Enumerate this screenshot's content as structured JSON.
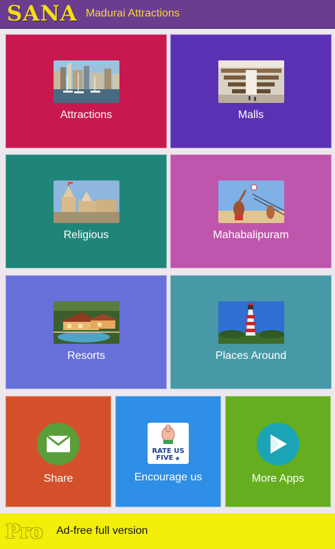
{
  "header": {
    "logo": "SANA",
    "title": "Madurai Attractions"
  },
  "tiles": [
    {
      "label": "Attractions",
      "color": "#c9174f",
      "icon": "harbor-photo-icon"
    },
    {
      "label": "Malls",
      "color": "#5b31b4",
      "icon": "mall-photo-icon"
    },
    {
      "label": "Religious",
      "color": "#1f8579",
      "icon": "temple-photo-icon"
    },
    {
      "label": "Mahabalipuram",
      "color": "#c055ad",
      "icon": "volleyball-photo-icon"
    },
    {
      "label": "Resorts",
      "color": "#6870d9",
      "icon": "resort-photo-icon"
    },
    {
      "label": "Places Around",
      "color": "#4799a7",
      "icon": "lighthouse-photo-icon"
    }
  ],
  "actions": [
    {
      "label": "Share",
      "color": "#d4502a",
      "icon": "mail-icon"
    },
    {
      "label": "Encourage us",
      "color": "#2f8ee5",
      "icon": "rate-us-five-icon",
      "badge_line1": "RATE US",
      "badge_line2": "FIVE"
    },
    {
      "label": "More Apps",
      "color": "#66ae1f",
      "icon": "play-store-icon"
    }
  ],
  "pro_banner": {
    "badge": "Pro",
    "text": "Ad-free full version",
    "color": "#f3ef0b"
  }
}
